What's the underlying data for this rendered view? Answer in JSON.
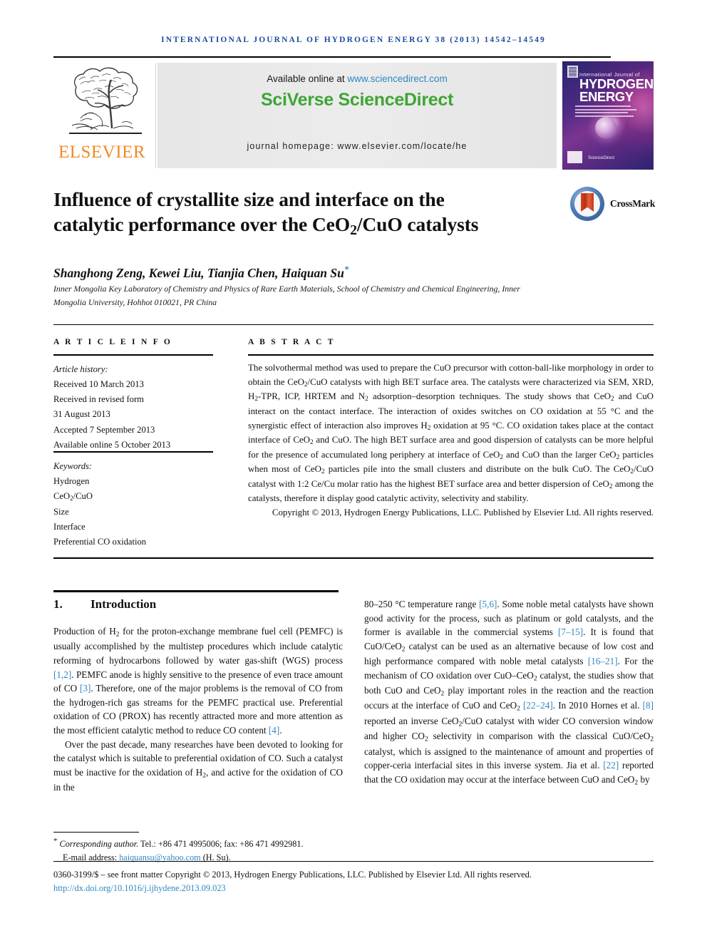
{
  "journal": {
    "running_head": "International Journal of Hydrogen Energy 38 (2013) 14542–14549",
    "available_online": "Available online at ",
    "sciencedirect_url": "www.sciencedirect.com",
    "sciverse_1": "SciVerse ",
    "sciverse_2": "ScienceDirect",
    "homepage": "journal homepage: www.elsevier.com/locate/he",
    "publisher_name": "ELSEVIER",
    "cover_small_title": "International Journal of",
    "cover_big_title": "HYDROGEN ENERGY",
    "cover_sd_label": "ScienceDirect"
  },
  "article": {
    "title": "Influence of crystallite size and interface on the catalytic performance over the CeO₂/CuO catalysts",
    "title_line1": "Influence of crystallite size and interface on the",
    "title_line2_pre": "catalytic performance over the CeO",
    "title_line2_sub": "2",
    "title_line2_post": "/CuO catalysts",
    "authors": "Shanghong Zeng, Kewei Liu, Tianjia Chen, Haiquan Su",
    "author_marker": "*",
    "affiliation": "Inner Mongolia Key Laboratory of Chemistry and Physics of Rare Earth Materials, School of Chemistry and Chemical Engineering, Inner Mongolia University, Hohhot 010021, PR China",
    "crossmark_label": "CrossMark"
  },
  "article_info": {
    "heading": "A R T I C L E   I N F O",
    "history_label": "Article history:",
    "history": [
      "Received 10 March 2013",
      "Received in revised form",
      "31 August 2013",
      "Accepted 7 September 2013",
      "Available online 5 October 2013"
    ],
    "keywords_label": "Keywords:",
    "keywords": [
      "Hydrogen",
      "CeO2/CuO",
      "Size",
      "Interface",
      "Preferential CO oxidation"
    ]
  },
  "abstract": {
    "heading": "A B S T R A C T",
    "text": "The solvothermal method was used to prepare the CuO precursor with cotton-ball-like morphology in order to obtain the CeO2/CuO catalysts with high BET surface area. The catalysts were characterized via SEM, XRD, H2-TPR, ICP, HRTEM and N2 adsorption–desorption techniques. The study shows that CeO2 and CuO interact on the contact interface. The interaction of oxides switches on CO oxidation at 55 °C and the synergistic effect of interaction also improves H2 oxidation at 95 °C. CO oxidation takes place at the contact interface of CeO2 and CuO. The high BET surface area and good dispersion of catalysts can be more helpful for the presence of accumulated long periphery at interface of CeO2 and CuO than the larger CeO2 particles when most of CeO2 particles pile into the small clusters and distribute on the bulk CuO. The CeO2/CuO catalyst with 1:2 Ce/Cu molar ratio has the highest BET surface area and better dispersion of CeO2 among the catalysts, therefore it display good catalytic activity, selectivity and stability.",
    "copyright": "Copyright © 2013, Hydrogen Energy Publications, LLC. Published by Elsevier Ltd. All rights reserved."
  },
  "introduction": {
    "number": "1.",
    "title": "Introduction",
    "left_paragraph_1": "Production of H2 for the proton-exchange membrane fuel cell (PEMFC) is usually accomplished by the multistep procedures which include catalytic reforming of hydrocarbons followed by water gas-shift (WGS) process [1,2]. PEMFC anode is highly sensitive to the presence of even trace amount of CO [3]. Therefore, one of the major problems is the removal of CO from the hydrogen-rich gas streams for the PEMFC practical use. Preferential oxidation of CO (PROX) has recently attracted more and more attention as the most efficient catalytic method to reduce CO content [4].",
    "left_paragraph_2": "Over the past decade, many researches have been devoted to looking for the catalyst which is suitable to preferential oxidation of CO. Such a catalyst must be inactive for the oxidation of H2, and active for the oxidation of CO in the",
    "right_paragraph_1": "80–250 °C temperature range [5,6]. Some noble metal catalysts have shown good activity for the process, such as platinum or gold catalysts, and the former is available in the commercial systems [7–15]. It is found that CuO/CeO2 catalyst can be used as an alternative because of low cost and high performance compared with noble metal catalysts [16–21]. For the mechanism of CO oxidation over CuO–CeO2 catalyst, the studies show that both CuO and CeO2 play important roles in the reaction and the reaction occurs at the interface of CuO and CeO2 [22–24]. In 2010 Hornes et al. [8] reported an inverse CeO2/CuO catalyst with wider CO conversion window and higher CO2 selectivity in comparison with the classical CuO/CeO2 catalyst, which is assigned to the maintenance of amount and properties of copper-ceria interfacial sites in this inverse system. Jia et al. [22] reported that the CO oxidation may occur at the interface between CuO and CeO2 by"
  },
  "footer": {
    "corresponding_marker": "*",
    "corresponding_label": "Corresponding author.",
    "corresponding_contact": " Tel.: +86 471 4995006; fax: +86 471 4992981.",
    "email_label": "E-mail address: ",
    "email": "haiquansu@yahoo.com",
    "email_suffix": " (H. Su).",
    "issn_line": "0360-3199/$ – see front matter Copyright © 2013, Hydrogen Energy Publications, LLC. Published by Elsevier Ltd. All rights reserved.",
    "doi": "http://dx.doi.org/10.1016/j.ijhydene.2013.09.023"
  },
  "colors": {
    "header_blue": "#1b4a9c",
    "link_blue": "#2f87c4",
    "elsevier_orange": "#f08a22",
    "sciencedirect_green": "#3fa535"
  }
}
